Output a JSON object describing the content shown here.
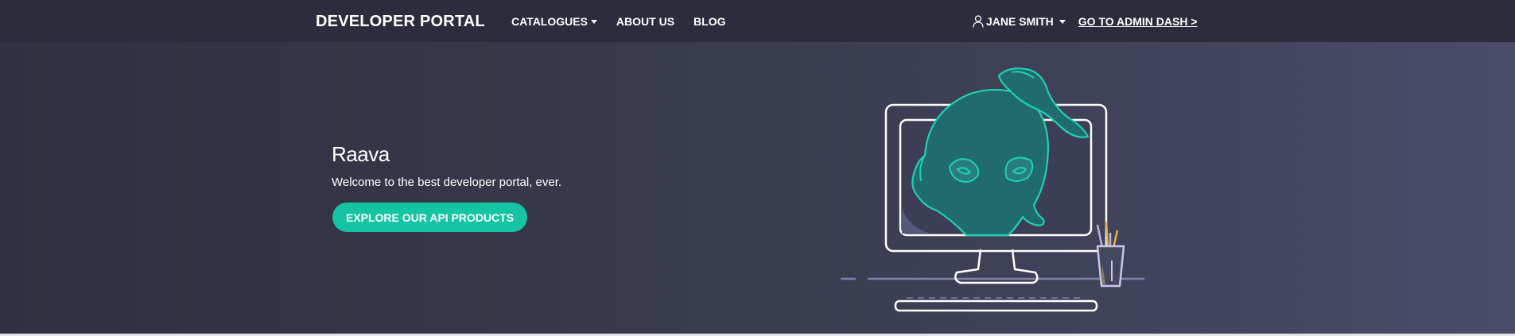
{
  "navbar": {
    "brand": "DEVELOPER PORTAL",
    "links": [
      {
        "label": "CATALOGUES",
        "has_dropdown": true
      },
      {
        "label": "ABOUT US"
      },
      {
        "label": "BLOG"
      }
    ],
    "user": {
      "name": "JANE SMITH",
      "icon": "user-icon"
    },
    "admin_link": "GO TO ADMIN DASH >"
  },
  "hero": {
    "logo": "Raava",
    "tagline": "Welcome to the best developer portal, ever.",
    "cta_label": "EXPLORE OUR API PRODUCTS",
    "illustration": "computer-with-mascot-illustration"
  },
  "colors": {
    "navbar_bg": "#2c2d3c",
    "accent": "#15c4a3",
    "mascot_fill": "#1f6b6e",
    "mascot_stroke": "#1dd3b0"
  }
}
